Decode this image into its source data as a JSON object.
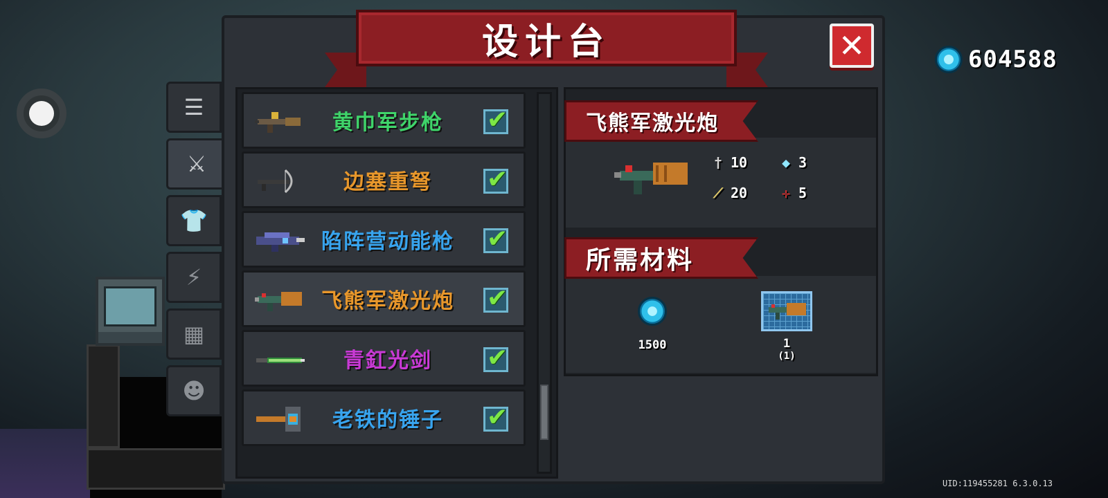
{
  "hud": {
    "currency_icon": "blue-gem-icon",
    "currency_amount": "604588",
    "uid_text": "UID:119455281 6.3.0.13"
  },
  "dialog": {
    "title": "设计台",
    "close_icon": "close-x-icon"
  },
  "side_tabs": [
    {
      "icon": "list-icon",
      "glyph": "☰",
      "active": false
    },
    {
      "icon": "weapon-icon",
      "glyph": "⚔",
      "active": true
    },
    {
      "icon": "armor-icon",
      "glyph": "👕",
      "active": false
    },
    {
      "icon": "lightning-icon",
      "glyph": "⚡",
      "active": false
    },
    {
      "icon": "materials-icon",
      "glyph": "▦",
      "active": false
    },
    {
      "icon": "character-icon",
      "glyph": "☻",
      "active": false
    }
  ],
  "recipes": [
    {
      "name": "黄巾军步枪",
      "color": "#3fd46a",
      "checked": true,
      "selected": false
    },
    {
      "name": "边塞重弩",
      "color": "#e8972b",
      "checked": true,
      "selected": false
    },
    {
      "name": "陷阵营动能枪",
      "color": "#38a4ee",
      "checked": true,
      "selected": false
    },
    {
      "name": "飞熊军激光炮",
      "color": "#e8972b",
      "checked": true,
      "selected": true
    },
    {
      "name": "青釭光剑",
      "color": "#c93ad6",
      "checked": true,
      "selected": false
    },
    {
      "name": "老铁的锤子",
      "color": "#38a4ee",
      "checked": true,
      "selected": false
    }
  ],
  "detail": {
    "weapon_name": "飞熊军激光炮",
    "stats": {
      "damage": "10",
      "energy_cost": "3",
      "critical": "20",
      "accuracy": "5"
    },
    "materials_title": "所需材料",
    "materials": [
      {
        "icon": "blue-gem-icon",
        "qty": "1500",
        "sub": ""
      },
      {
        "icon": "blueprint-icon",
        "qty": "1",
        "sub": "(1)"
      }
    ]
  },
  "colors": {
    "ribbon_red": "#8c1e23",
    "check_green": "#7de845",
    "panel": "#2d3137"
  }
}
